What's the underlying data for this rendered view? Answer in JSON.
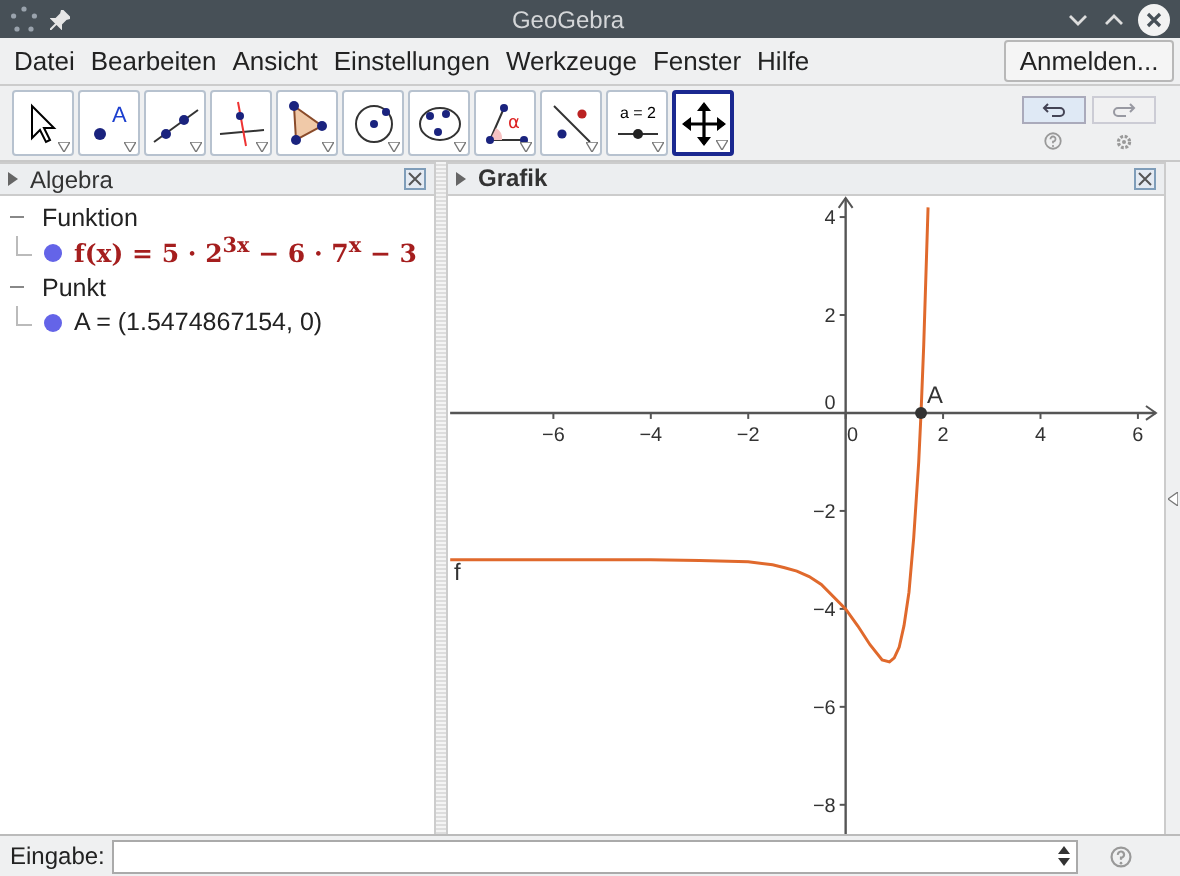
{
  "window": {
    "title": "GeoGebra"
  },
  "menu": {
    "items": [
      "Datei",
      "Bearbeiten",
      "Ansicht",
      "Einstellungen",
      "Werkzeuge",
      "Fenster",
      "Hilfe"
    ],
    "sign_in": "Anmelden..."
  },
  "toolbar": {
    "tools": [
      {
        "kind": "move",
        "selected": false
      },
      {
        "kind": "point",
        "label": "A",
        "selected": false
      },
      {
        "kind": "line",
        "selected": false
      },
      {
        "kind": "perpendicular",
        "selected": false
      },
      {
        "kind": "polygon",
        "selected": false
      },
      {
        "kind": "circle",
        "selected": false
      },
      {
        "kind": "conic",
        "selected": false
      },
      {
        "kind": "angle",
        "label": "α",
        "selected": false
      },
      {
        "kind": "reflect",
        "selected": false
      },
      {
        "kind": "slider",
        "label": "a = 2",
        "selected": false
      },
      {
        "kind": "move-view",
        "selected": true
      }
    ],
    "undo": {
      "disabled": false
    },
    "redo": {
      "disabled": true
    }
  },
  "algebra": {
    "title": "Algebra",
    "groups": [
      {
        "label": "Funktion",
        "expanded": true,
        "children": [
          {
            "kind": "function",
            "text": "f(x) = 5 · 2$^{3x}$ − 6 · 7$^{x}$ − 3"
          }
        ]
      },
      {
        "label": "Punkt",
        "expanded": true,
        "children": [
          {
            "kind": "point",
            "text": "A = (1.5474867154, 0)"
          }
        ]
      }
    ]
  },
  "graphics": {
    "title": "Grafik",
    "chart_data": {
      "type": "line",
      "x": [
        -8.12,
        -6,
        -4,
        -3,
        -2,
        -1.5,
        -1.25,
        -1,
        -0.75,
        -0.5,
        0,
        0.25,
        0.5,
        0.75,
        0.9,
        1,
        1.1,
        1.2,
        1.3,
        1.4,
        1.5,
        1.55,
        1.6,
        1.69
      ],
      "series": [
        {
          "name": "f",
          "color": "#e0692c",
          "values": [
            -3,
            -3,
            -3,
            -3.01,
            -3.04,
            -3.1,
            -3.16,
            -3.23,
            -3.34,
            -3.5,
            -4,
            -4.35,
            -4.73,
            -5.04,
            -5.08,
            -5,
            -4.78,
            -4.34,
            -3.66,
            -2.54,
            -1,
            0.03,
            1.36,
            4.2
          ]
        }
      ],
      "xlim": [
        -8.12,
        6.41
      ],
      "ylim": [
        -8.6,
        4.43
      ],
      "xticks": [
        {
          "value": -6,
          "label": "−6"
        },
        {
          "value": -4,
          "label": "−4"
        },
        {
          "value": -2,
          "label": "−2"
        },
        {
          "value": 0,
          "label": "0"
        },
        {
          "value": 2,
          "label": "2"
        },
        {
          "value": 4,
          "label": "4"
        },
        {
          "value": 6,
          "label": "6"
        }
      ],
      "yticks": [
        {
          "value": -8,
          "label": "−8"
        },
        {
          "value": -6,
          "label": "−6"
        },
        {
          "value": -4,
          "label": "−4"
        },
        {
          "value": -2,
          "label": "−2"
        },
        {
          "value": 0,
          "label": "0"
        },
        {
          "value": 2,
          "label": "2"
        },
        {
          "value": 4,
          "label": "4"
        }
      ],
      "annotations": [
        {
          "x": 1.5475,
          "y": 0,
          "text": "A"
        }
      ]
    }
  },
  "input_bar": {
    "label": "Eingabe:"
  }
}
